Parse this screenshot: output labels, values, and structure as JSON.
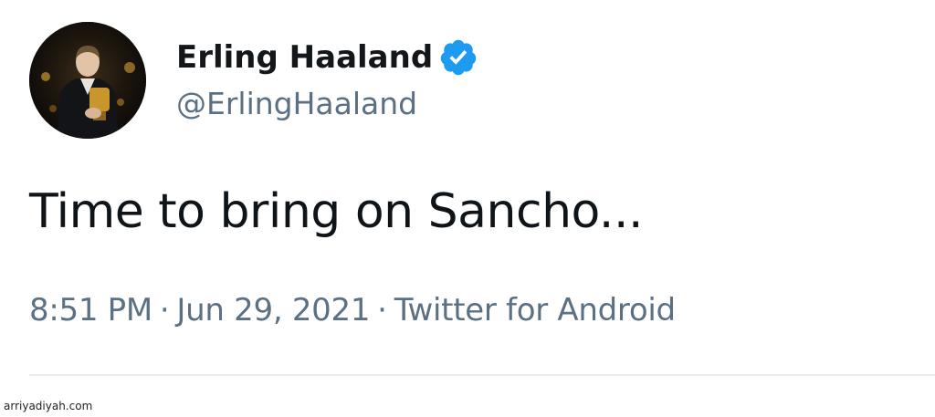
{
  "author": {
    "display_name": "Erling Haaland",
    "handle": "@ErlingHaaland",
    "verified": true
  },
  "tweet": {
    "text": "Time to bring on Sancho...",
    "time": "8:51 PM",
    "date": "Jun 29, 2021",
    "source": "Twitter for Android",
    "separator": "·"
  },
  "watermark": "arriyadiyah.com",
  "icons": {
    "avatar": "profile-photo",
    "verified": "verified-badge-icon"
  },
  "colors": {
    "verified_blue": "#1d9bf0",
    "name_text": "#14171a",
    "secondary_text": "#5b7083",
    "divider": "#e6ecf0"
  }
}
